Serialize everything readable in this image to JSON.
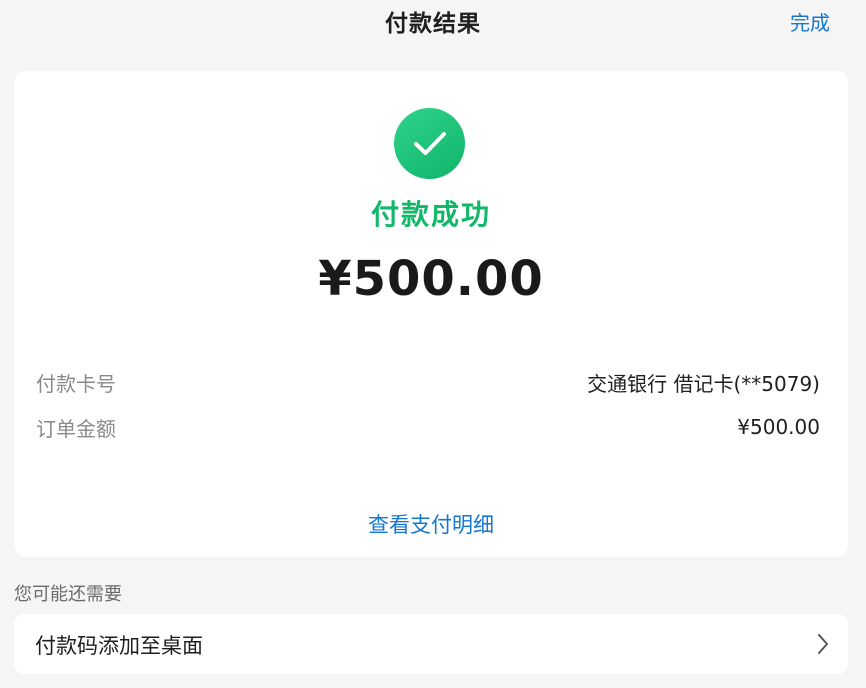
{
  "header": {
    "title": "付款结果",
    "done_label": "完成"
  },
  "result": {
    "icon": "check-icon",
    "status": "付款成功",
    "amount": "¥500.00",
    "status_color": "#10b868",
    "details": [
      {
        "label": "付款卡号",
        "value": "交通银行 借记卡(**5079)"
      },
      {
        "label": "订单金额",
        "value": "¥500.00"
      }
    ],
    "view_detail_label": "查看支付明细"
  },
  "suggestions": {
    "title": "您可能还需要",
    "items": [
      {
        "label": "付款码添加至桌面",
        "icon": "chevron-right-icon"
      }
    ]
  },
  "colors": {
    "accent": "#1677d2",
    "success": "#10b868",
    "background": "#f5f5f5"
  }
}
